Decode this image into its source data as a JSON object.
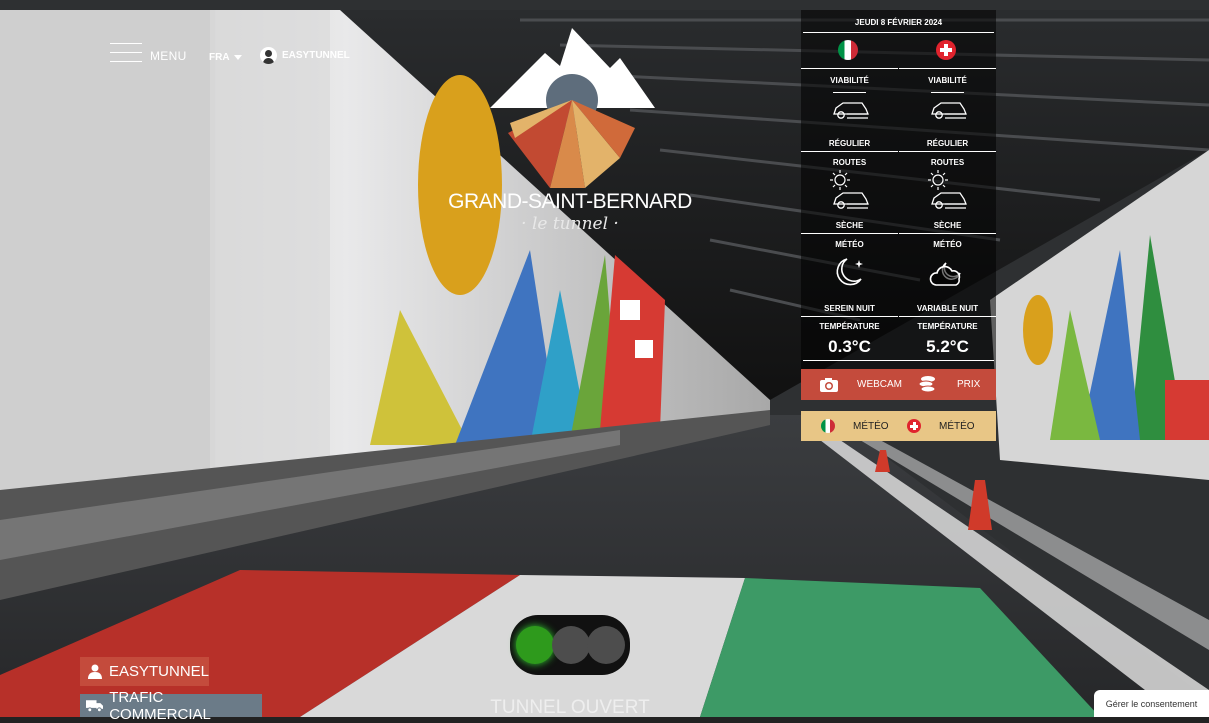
{
  "header": {
    "menu_label": "MENU",
    "language": "FRA",
    "user_label": "EASYTUNNEL"
  },
  "brand": {
    "name": "GRAND-SAINT-BERNARD",
    "subtitle": "· le tunnel ·"
  },
  "panel": {
    "date": "JEUDI 8 FÉVRIER 2024",
    "italy": {
      "viability_label": "VIABILITÉ",
      "viability_value": "RÉGULIER",
      "roads_label": "ROUTES",
      "roads_value": "SÈCHE",
      "weather_label": "MÉTÉO",
      "weather_value": "SEREIN NUIT",
      "temp_label": "TEMPÉRATURE",
      "temp_value": "0.3°C"
    },
    "switzerland": {
      "viability_label": "VIABILITÉ",
      "viability_value": "RÉGULIER",
      "roads_label": "ROUTES",
      "roads_value": "SÈCHE",
      "weather_label": "MÉTÉO",
      "weather_value": "VARIABLE NUIT",
      "temp_label": "TEMPÉRATURE",
      "temp_value": "5.2°C"
    },
    "webcam_label": "WEBCAM",
    "price_label": "PRIX",
    "meteo_it_label": "MÉTÉO",
    "meteo_ch_label": "MÉTÉO"
  },
  "bottom": {
    "easytunnel_label": "EASYTUNNEL",
    "commercial_label": "TRAFIC COMMERCIAL",
    "status": "TUNNEL OUVERT",
    "consent": "Gérer le consentement"
  },
  "icons": {
    "menu": "hamburger-icon",
    "user": "user-icon",
    "car": "car-icon",
    "sun": "sun-icon",
    "moon": "moon-star-icon",
    "cloud_moon": "cloud-moon-icon",
    "camera": "camera-icon",
    "coins": "coins-icon",
    "truck": "truck-icon"
  },
  "colors": {
    "accent_red": "#c44b3c",
    "accent_gold": "#e8c686",
    "commercial_grey": "#6b7b88",
    "light_green": "#2e9a1c"
  },
  "traffic_light": {
    "active": "green"
  }
}
